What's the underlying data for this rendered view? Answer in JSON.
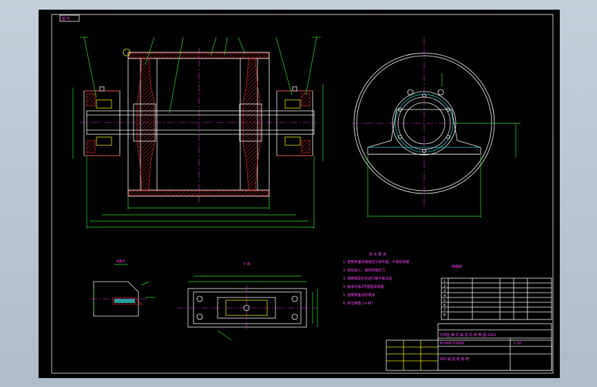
{
  "drawing": {
    "tag": "图 号 ",
    "view_label": "P 向",
    "section_label": "A放大",
    "title_line1": "DTⅡ型 带 式 输 送 机 卷 筒 图 2002",
    "title_line2": "B=800 D1400",
    "title_line3": "NOI 输 送 机 卷 筒",
    "scale": "1:10",
    "note_header": "技 术 要 求",
    "notes": [
      "1. 卷筒表面焊接缝应光滑平整，不得有砂眼",
      "2. 焊后退火，消除焊接应力",
      "3. 滚筒装配后应进行静平衡试验",
      "4. 轴承内装2号锂基润滑脂",
      "5. 滚筒表面涂防锈漆",
      "6. 未注倒角 1×45°"
    ],
    "parts_header": "明细表",
    "part_numbers": [
      "1",
      "2",
      "3",
      "4",
      "5",
      "6",
      "7",
      "8"
    ]
  },
  "colors": {
    "background": "#000000",
    "outline": "#ffffff",
    "dimension": "#2ee82e",
    "centerline": "#ff2bff",
    "hatch": "#ff3030",
    "hidden": "#28e0e0",
    "text": "#ff44ff"
  }
}
